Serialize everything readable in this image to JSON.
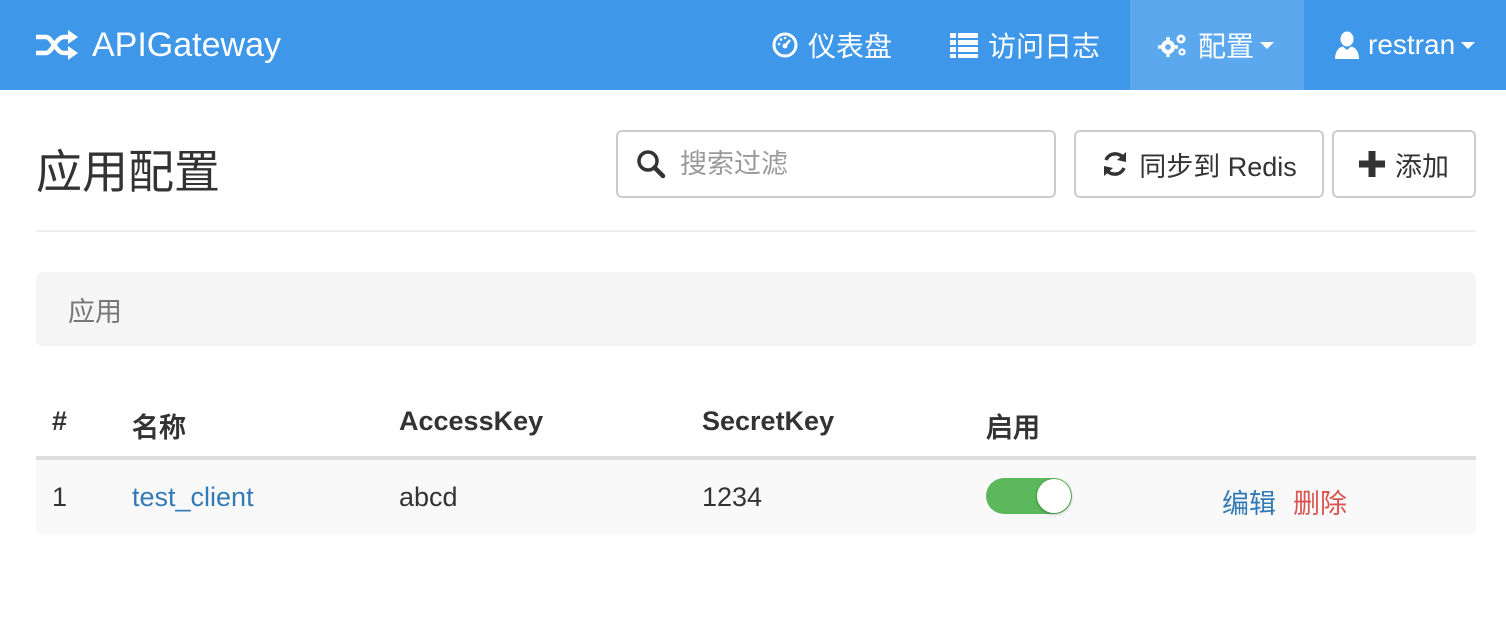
{
  "navbar": {
    "brand": "APIGateway",
    "items": [
      {
        "label": "仪表盘",
        "icon": "dashboard-icon"
      },
      {
        "label": "访问日志",
        "icon": "list-icon"
      },
      {
        "label": "配置",
        "icon": "cogs-icon",
        "active": true,
        "dropdown": true
      },
      {
        "label": "restran",
        "icon": "user-icon",
        "dropdown": true
      }
    ]
  },
  "page": {
    "title": "应用配置",
    "search_placeholder": "搜索过滤",
    "sync_label": "同步到 Redis",
    "add_label": "添加"
  },
  "breadcrumb": {
    "current": "应用"
  },
  "table": {
    "columns": [
      "#",
      "名称",
      "AccessKey",
      "SecretKey",
      "启用",
      ""
    ],
    "rows": [
      {
        "index": "1",
        "name": "test_client",
        "access_key": "abcd",
        "secret_key": "1234",
        "enabled": true,
        "edit_label": "编辑",
        "delete_label": "删除"
      }
    ]
  },
  "colors": {
    "navbar_bg": "#3f97e9",
    "navbar_active_bg": "#5ba8ee",
    "link": "#337ab7",
    "danger": "#d9534f",
    "toggle_on": "#5cb85c"
  }
}
